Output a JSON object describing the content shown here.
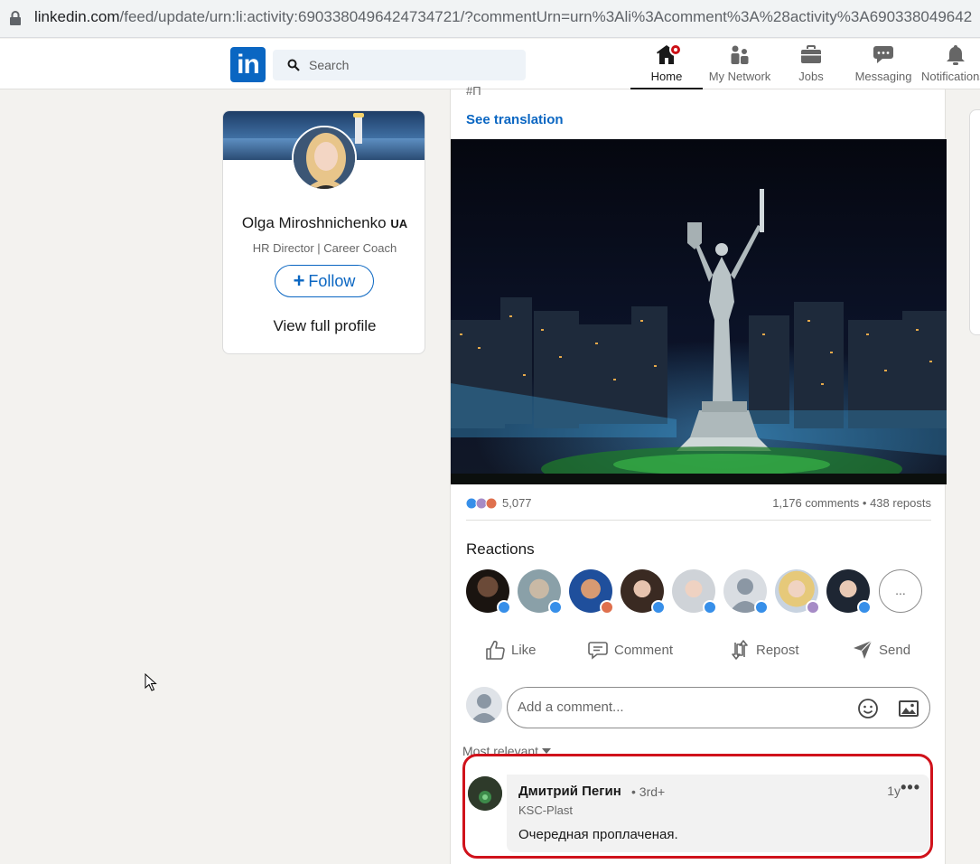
{
  "browser": {
    "url_main": "linkedin.com",
    "url_rest": "/feed/update/urn:li:activity:6903380496424734721/?commentUrn=urn%3Ali%3Acomment%3A%28activity%3A690338049642"
  },
  "nav": {
    "logo": "in",
    "search_placeholder": "Search",
    "items": [
      {
        "label": "Home"
      },
      {
        "label": "My Network"
      },
      {
        "label": "Jobs"
      },
      {
        "label": "Messaging"
      },
      {
        "label": "Notifications"
      }
    ]
  },
  "profile": {
    "name": "Olga Miroshnichenko",
    "name_suffix": "UA",
    "headline": "HR Director | Career Coach",
    "follow_label": "Follow",
    "view_profile_label": "View full profile"
  },
  "post": {
    "cut_text": "#П",
    "see_translation": "See translation",
    "reaction_count": "5,077",
    "comments_reposts": "1,176 comments • 438 reposts",
    "reactions_heading": "Reactions",
    "more_reactors": "...",
    "actions": {
      "like": "Like",
      "comment": "Comment",
      "repost": "Repost",
      "send": "Send"
    },
    "comment_placeholder": "Add a comment...",
    "sort_label": "Most relevant"
  },
  "comment": {
    "author": "Дмитрий Пегин",
    "degree": "• 3rd+",
    "company": "KSC-Plast",
    "text": "Очередная проплаченая.",
    "time": "1y",
    "more": "•••"
  },
  "colors": {
    "brand": "#0a66c2",
    "highlight": "#d0121b",
    "background": "#f3f2ef"
  }
}
